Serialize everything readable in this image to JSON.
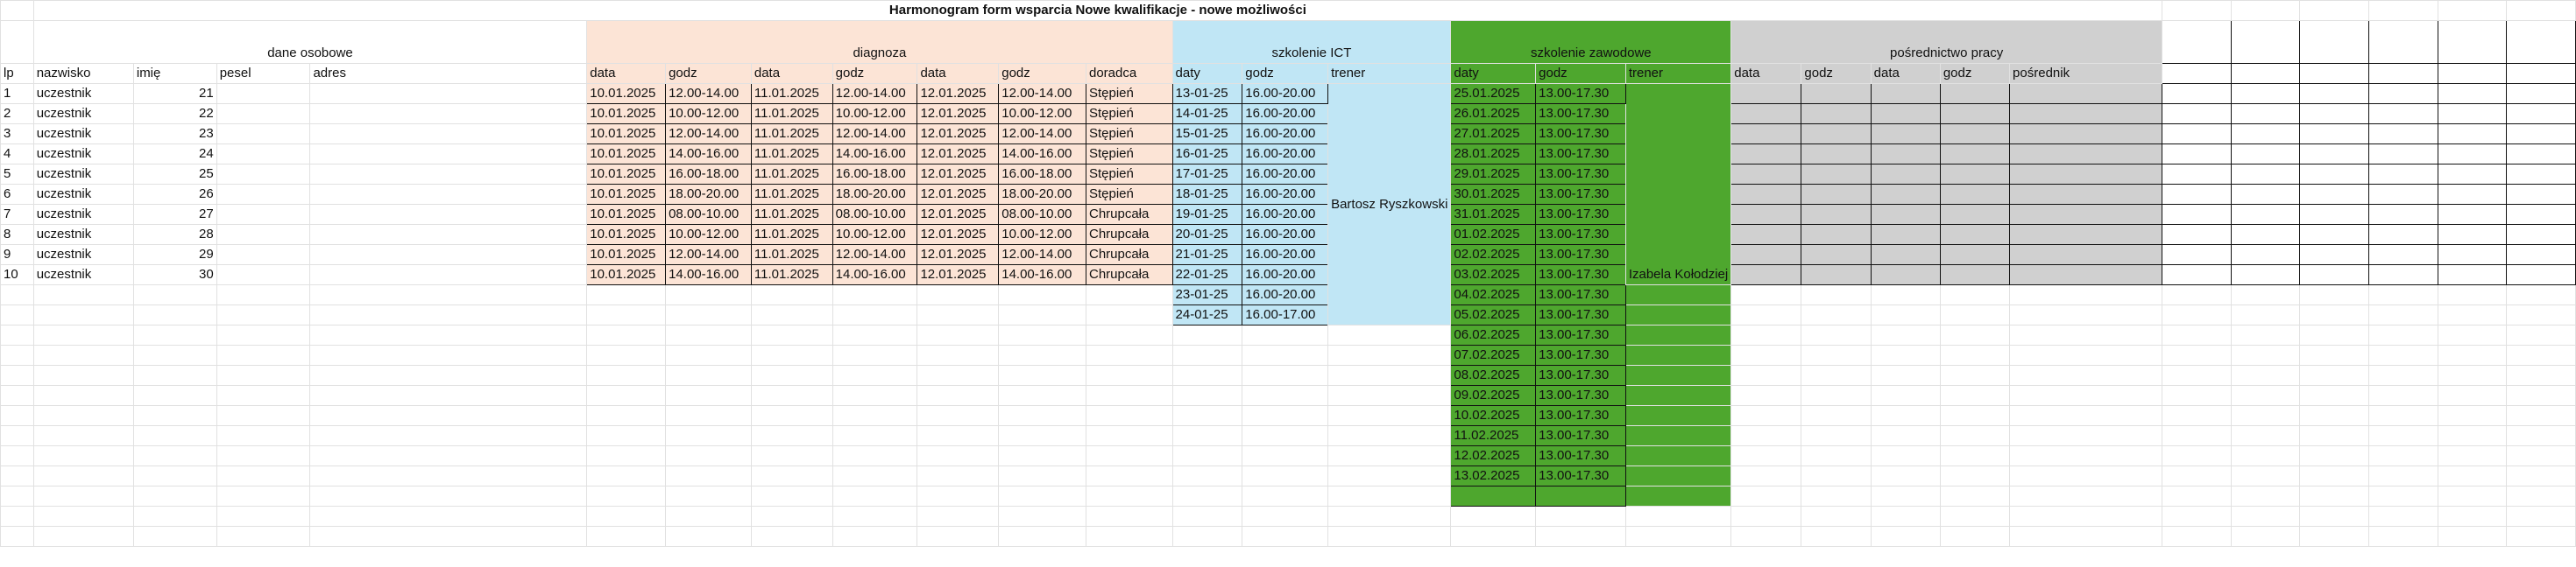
{
  "title": "Harmonogram form wsparcia Nowe kwalifikacje - nowe możliwości",
  "groups": {
    "personal": "dane osobowe",
    "diagnosis": "diagnoza",
    "ict": "szkolenie ICT",
    "vocational": "szkolenie zawodowe",
    "placement": "pośrednictwo pracy"
  },
  "headers": {
    "lp": "lp",
    "nazwisko": "nazwisko",
    "imie": "imię",
    "pesel": "pesel",
    "adres": "adres",
    "data": "data",
    "godz": "godz",
    "doradca": "doradca",
    "daty": "daty",
    "trener": "trener",
    "posrednik": "pośrednik"
  },
  "trainers": {
    "ict": "Bartosz Ryszkowski",
    "vocational": "Izabela Kołodziej"
  },
  "colors": {
    "diagnosis": "#fce4d6",
    "ict": "#c0e6f5",
    "vocational": "#4ea72e",
    "placement": "#d0d0d0"
  },
  "participants": [
    {
      "lp": "1",
      "nazwisko": "uczestnik",
      "imie": "21",
      "d1": "10.01.2025",
      "g1": "12.00-14.00",
      "d2": "11.01.2025",
      "g2": "12.00-14.00",
      "d3": "12.01.2025",
      "g3": "12.00-14.00",
      "doradca": "Stępień"
    },
    {
      "lp": "2",
      "nazwisko": "uczestnik",
      "imie": "22",
      "d1": "10.01.2025",
      "g1": "10.00-12.00",
      "d2": "11.01.2025",
      "g2": "10.00-12.00",
      "d3": "12.01.2025",
      "g3": "10.00-12.00",
      "doradca": "Stępień"
    },
    {
      "lp": "3",
      "nazwisko": "uczestnik",
      "imie": "23",
      "d1": "10.01.2025",
      "g1": "12.00-14.00",
      "d2": "11.01.2025",
      "g2": "12.00-14.00",
      "d3": "12.01.2025",
      "g3": "12.00-14.00",
      "doradca": "Stępień"
    },
    {
      "lp": "4",
      "nazwisko": "uczestnik",
      "imie": "24",
      "d1": "10.01.2025",
      "g1": "14.00-16.00",
      "d2": "11.01.2025",
      "g2": "14.00-16.00",
      "d3": "12.01.2025",
      "g3": "14.00-16.00",
      "doradca": "Stępień"
    },
    {
      "lp": "5",
      "nazwisko": "uczestnik",
      "imie": "25",
      "d1": "10.01.2025",
      "g1": "16.00-18.00",
      "d2": "11.01.2025",
      "g2": "16.00-18.00",
      "d3": "12.01.2025",
      "g3": "16.00-18.00",
      "doradca": "Stępień"
    },
    {
      "lp": "6",
      "nazwisko": "uczestnik",
      "imie": "26",
      "d1": "10.01.2025",
      "g1": "18.00-20.00",
      "d2": "11.01.2025",
      "g2": "18.00-20.00",
      "d3": "12.01.2025",
      "g3": "18.00-20.00",
      "doradca": "Stępień"
    },
    {
      "lp": "7",
      "nazwisko": "uczestnik",
      "imie": "27",
      "d1": "10.01.2025",
      "g1": "08.00-10.00",
      "d2": "11.01.2025",
      "g2": "08.00-10.00",
      "d3": "12.01.2025",
      "g3": "08.00-10.00",
      "doradca": "Chrupcała"
    },
    {
      "lp": "8",
      "nazwisko": "uczestnik",
      "imie": "28",
      "d1": "10.01.2025",
      "g1": "10.00-12.00",
      "d2": "11.01.2025",
      "g2": "10.00-12.00",
      "d3": "12.01.2025",
      "g3": "10.00-12.00",
      "doradca": "Chrupcała"
    },
    {
      "lp": "9",
      "nazwisko": "uczestnik",
      "imie": "29",
      "d1": "10.01.2025",
      "g1": "12.00-14.00",
      "d2": "11.01.2025",
      "g2": "12.00-14.00",
      "d3": "12.01.2025",
      "g3": "12.00-14.00",
      "doradca": "Chrupcała"
    },
    {
      "lp": "10",
      "nazwisko": "uczestnik",
      "imie": "30",
      "d1": "10.01.2025",
      "g1": "14.00-16.00",
      "d2": "11.01.2025",
      "g2": "14.00-16.00",
      "d3": "12.01.2025",
      "g3": "14.00-16.00",
      "doradca": "Chrupcała"
    }
  ],
  "ict_schedule": [
    {
      "date": "13-01-25",
      "hours": "16.00-20.00"
    },
    {
      "date": "14-01-25",
      "hours": "16.00-20.00"
    },
    {
      "date": "15-01-25",
      "hours": "16.00-20.00"
    },
    {
      "date": "16-01-25",
      "hours": "16.00-20.00"
    },
    {
      "date": "17-01-25",
      "hours": "16.00-20.00"
    },
    {
      "date": "18-01-25",
      "hours": "16.00-20.00"
    },
    {
      "date": "19-01-25",
      "hours": "16.00-20.00"
    },
    {
      "date": "20-01-25",
      "hours": "16.00-20.00"
    },
    {
      "date": "21-01-25",
      "hours": "16.00-20.00"
    },
    {
      "date": "22-01-25",
      "hours": "16.00-20.00"
    },
    {
      "date": "23-01-25",
      "hours": "16.00-20.00"
    },
    {
      "date": "24-01-25",
      "hours": "16.00-17.00"
    }
  ],
  "vocational_schedule": [
    {
      "date": "25.01.2025",
      "hours": "13.00-17.30"
    },
    {
      "date": "26.01.2025",
      "hours": "13.00-17.30"
    },
    {
      "date": "27.01.2025",
      "hours": "13.00-17.30"
    },
    {
      "date": "28.01.2025",
      "hours": "13.00-17.30"
    },
    {
      "date": "29.01.2025",
      "hours": "13.00-17.30"
    },
    {
      "date": "30.01.2025",
      "hours": "13.00-17.30"
    },
    {
      "date": "31.01.2025",
      "hours": "13.00-17.30"
    },
    {
      "date": "01.02.2025",
      "hours": "13.00-17.30"
    },
    {
      "date": "02.02.2025",
      "hours": "13.00-17.30"
    },
    {
      "date": "03.02.2025",
      "hours": "13.00-17.30"
    },
    {
      "date": "04.02.2025",
      "hours": "13.00-17.30"
    },
    {
      "date": "05.02.2025",
      "hours": "13.00-17.30"
    },
    {
      "date": "06.02.2025",
      "hours": "13.00-17.30"
    },
    {
      "date": "07.02.2025",
      "hours": "13.00-17.30"
    },
    {
      "date": "08.02.2025",
      "hours": "13.00-17.30"
    },
    {
      "date": "09.02.2025",
      "hours": "13.00-17.30"
    },
    {
      "date": "10.02.2025",
      "hours": "13.00-17.30"
    },
    {
      "date": "11.02.2025",
      "hours": "13.00-17.30"
    },
    {
      "date": "12.02.2025",
      "hours": "13.00-17.30"
    },
    {
      "date": "13.02.2025",
      "hours": "13.00-17.30"
    }
  ]
}
